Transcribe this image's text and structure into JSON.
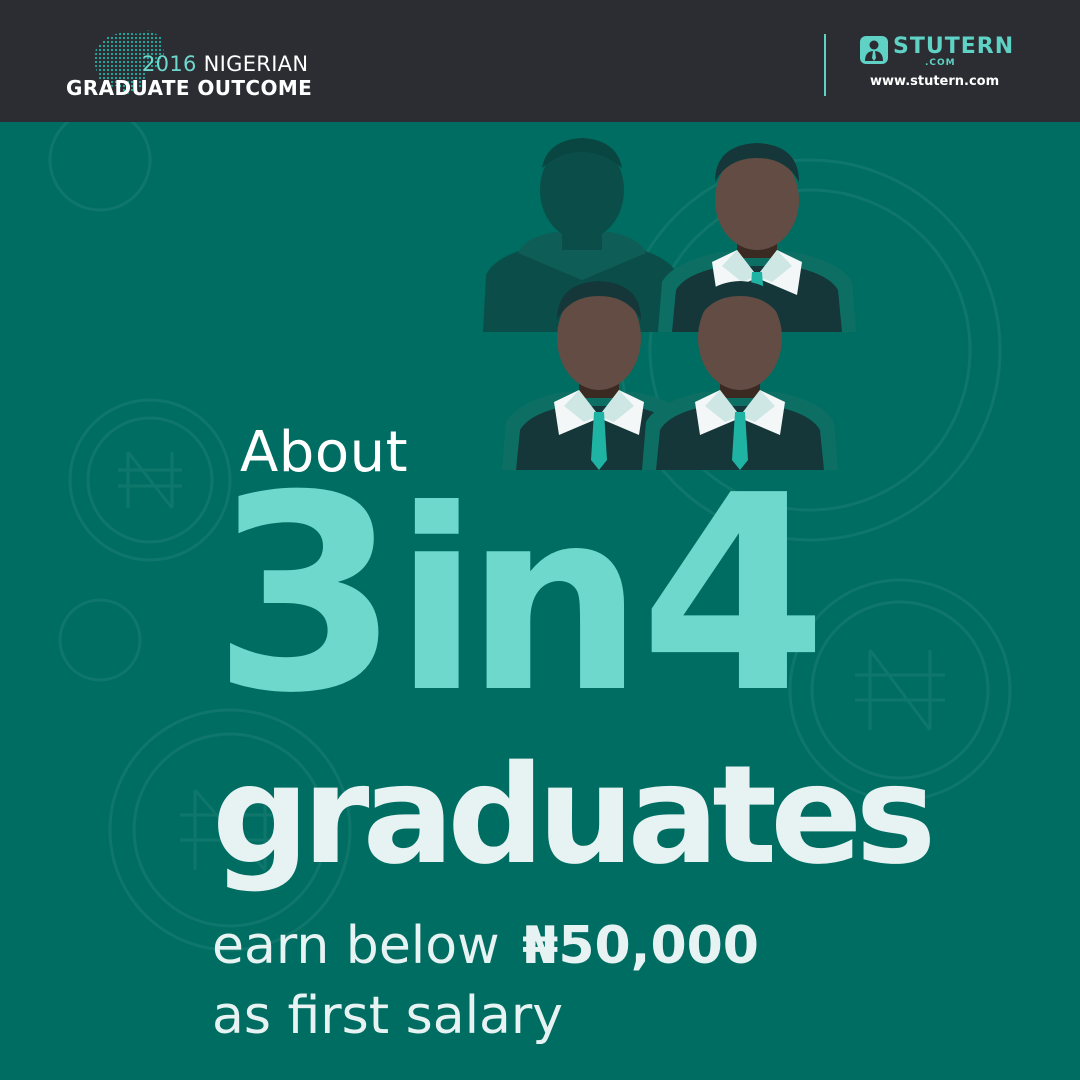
{
  "header": {
    "year": "2016",
    "title_line1": "NIGERIAN",
    "title_line2": "GRADUATE OUTCOME",
    "brand": "STUTERN",
    "brand_suffix": ".COM",
    "url": "www.stutern.com"
  },
  "headline": {
    "prefix": "About",
    "numerator": "3",
    "connector": "in",
    "denominator": "4",
    "subject": "graduates",
    "verb_phrase": "earn below",
    "amount": "₦50,000",
    "suffix": "as first salary"
  },
  "colors": {
    "header_bg": "#2b2d33",
    "background": "#006d62",
    "accent": "#6fd8cd",
    "text_light": "#e6f3f2"
  },
  "icons": {
    "header_map": "nigeria-map-icon",
    "logo": "stutern-logo-icon",
    "background_coins": "naira-coin-icon",
    "people": "graduate-person-icon"
  }
}
